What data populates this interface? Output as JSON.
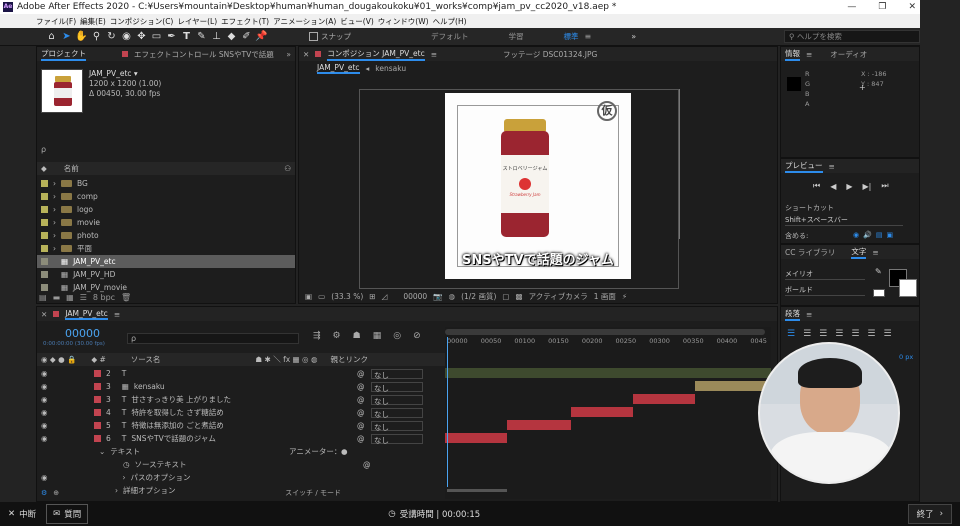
{
  "window": {
    "title": "Adobe After Effects 2020 - C:¥Users¥mountain¥Desktop¥human¥human_dougakoukoku¥01_works¥comp¥jam_pv_cc2020_v18.aep *",
    "min": "—",
    "max": "❐",
    "close": "✕"
  },
  "menu": [
    "ファイル(F)",
    "編集(E)",
    "コンポジション(C)",
    "レイヤー(L)",
    "エフェクト(T)",
    "アニメーション(A)",
    "ビュー(V)",
    "ウィンドウ(W)",
    "ヘルプ(H)"
  ],
  "toolbar": {
    "snap": "スナップ",
    "workspaces": [
      "デフォルト",
      "学習",
      "標準"
    ],
    "search_placeholder": "ヘルプを検索"
  },
  "project": {
    "tab": "プロジェクト",
    "effects_tab": "エフェクトコントロール SNSやTVで話題",
    "item_name": "JAM_PV_etc ▾",
    "item_size": "1200 x 1200 (1.00)",
    "item_dur": "Δ 00450, 30.00 fps",
    "search": "ρ",
    "col_name": "名前",
    "items": [
      {
        "name": "BG",
        "type": "folder"
      },
      {
        "name": "comp",
        "type": "folder"
      },
      {
        "name": "logo",
        "type": "folder"
      },
      {
        "name": "movie",
        "type": "folder"
      },
      {
        "name": "photo",
        "type": "folder"
      },
      {
        "name": "平面",
        "type": "folder"
      },
      {
        "name": "JAM_PV_etc",
        "type": "comp"
      },
      {
        "name": "JAM_PV_HD",
        "type": "comp"
      },
      {
        "name": "JAM_PV_movie",
        "type": "comp"
      }
    ],
    "bpc": "8 bpc"
  },
  "comp": {
    "tab": "コンポジション JAM_PV_etc",
    "footage_tab": "フッテージ DSC01324.JPG",
    "subtabs": [
      "JAM_PV_etc",
      "kensaku"
    ],
    "jar_label_top": "ストロベリージャム",
    "jar_label_sub": "Strawberry Jam",
    "stamp": "仮",
    "caption": "SNSやTVで話題のジャム",
    "zoom": "(33.3 %)",
    "time": "00000",
    "res": "(1/2 画質)",
    "camera": "アクティブカメラ",
    "views": "1 画面"
  },
  "info": {
    "tab": "情報",
    "audio_tab": "オーディオ",
    "r": "R",
    "g": "G",
    "b": "B",
    "a": "A",
    "x": "X : -186",
    "y": "Y : 847"
  },
  "preview": {
    "tab": "プレビュー",
    "shortcut_label": "ショートカット",
    "shortcut_value": "Shift+スペースバー",
    "include": "含める:"
  },
  "char": {
    "lib_tab": "CC ライブラリ",
    "tab": "文字",
    "font": "メイリオ",
    "style": "ボールド"
  },
  "para": {
    "tab": "段落",
    "value": "0 px"
  },
  "timeline": {
    "tab": "JAM_PV_etc",
    "time": "00000",
    "subtime": "0:00:00:00 (30.00 fps)",
    "search": "ρ",
    "col_source": "ソース名",
    "col_parent": "親とリンク",
    "none": "なし",
    "layers": [
      {
        "num": "2",
        "name": "",
        "color": "#c24450"
      },
      {
        "num": "3",
        "name": "kensaku",
        "color": "#c24450"
      },
      {
        "num": "3",
        "name": "甘さすっきり美 上がりました",
        "color": "#c24450"
      },
      {
        "num": "4",
        "name": "特許を取得した さず糖詰め",
        "color": "#c24450"
      },
      {
        "num": "5",
        "name": "特徴は無添加の ごと煮詰め",
        "color": "#c24450"
      },
      {
        "num": "6",
        "name": "SNSやTVで話題のジャム",
        "color": "#c24450"
      }
    ],
    "props": [
      "テキスト",
      "ソーステキスト",
      "パスのオプション",
      "詳細オプション"
    ],
    "animator": "アニメーター：",
    "ruler": [
      "00000",
      "00050",
      "00100",
      "00150",
      "00200",
      "00250",
      "00300",
      "00350",
      "00400",
      "0045"
    ],
    "switches": "スイッチ / モード"
  },
  "bottom": {
    "pause": "中断",
    "question": "質問",
    "time_label": "受講時間 | 00:00:15",
    "end": "終了"
  }
}
